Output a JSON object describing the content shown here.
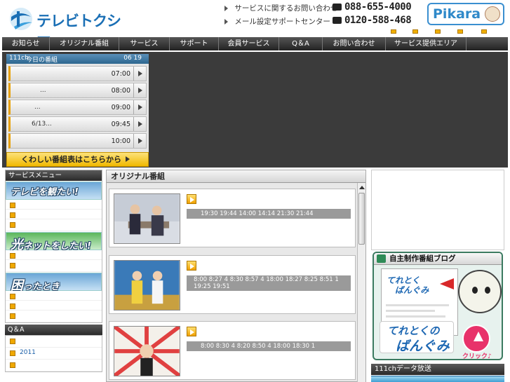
{
  "header": {
    "logo_text": "テレビトクシマ",
    "contact_rows": [
      {
        "label": "サービスに関するお問い合わせ",
        "phone": "088-655-4000"
      },
      {
        "label": "メール設定サポートセンター",
        "phone": "0120-588-468"
      }
    ],
    "pikara_label": "Pikara"
  },
  "nav": {
    "items": [
      "お知らせ",
      "オリジナル番組",
      "サービス",
      "サポート",
      "会員サービス",
      "Q＆A",
      "お問い合わせ",
      "サービス提供エリア"
    ]
  },
  "schedule": {
    "channel": "111ch",
    "title": "今日の番組",
    "date": "06 19",
    "rows": [
      {
        "program": "",
        "time": "07:00"
      },
      {
        "program": "...",
        "time": "08:00"
      },
      {
        "program": "...",
        "time": "09:00"
      },
      {
        "program": "6/13...",
        "time": "09:45"
      },
      {
        "program": "",
        "time": "10:00"
      }
    ],
    "more_button": "くわしい番組表はこちらから"
  },
  "sidebar": {
    "menu_title": "サービスメニュー",
    "banner_tv": "テレビを観たい!",
    "banner_net_big": "光",
    "banner_net": "ネットをしたい!",
    "banner_help_big": "困",
    "banner_help": "ったとき",
    "qa_title": "Q＆A",
    "qa_items": [
      "",
      "2011",
      ""
    ]
  },
  "center": {
    "title": "オリジナル番組",
    "cards": [
      {
        "schedule": "19:30 19:44    14:00 14:14    21:30 21:44"
      },
      {
        "schedule": "8:00 8:27 4     8:30 8:57 4     18:00 18:27    8:25 8:51 1 19:25 19:51"
      },
      {
        "schedule": "8:00 8:30 4     8:20 8:50  4     18:00 18:30 1"
      }
    ]
  },
  "right": {
    "blog_title": "自主制作番組ブログ",
    "blog_logo_small_1": "てれとく",
    "blog_logo_small_2": "ばんぐみ",
    "blog_logo_big_1": "てれとくの",
    "blog_logo_big_2": "ばんぐみ",
    "click_label": "クリック♪",
    "data_title": "111chデータ放送"
  }
}
